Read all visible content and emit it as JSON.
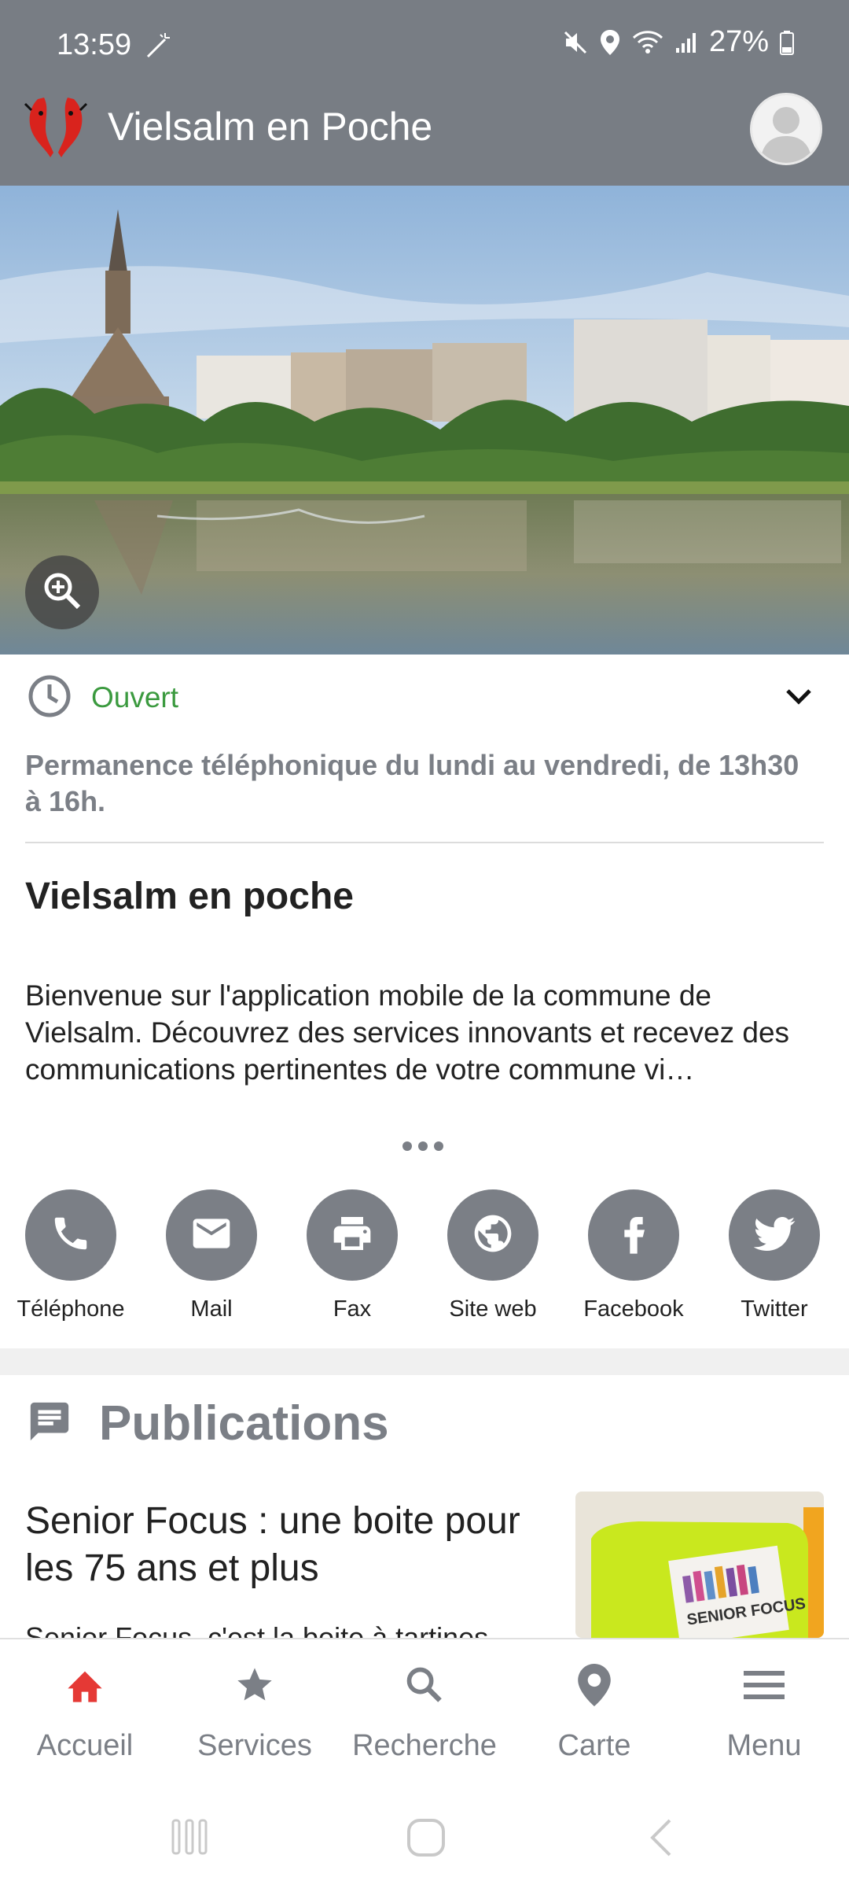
{
  "status_bar": {
    "time": "13:59",
    "battery": "27%"
  },
  "app_bar": {
    "title": "Vielsalm en Poche"
  },
  "hours": {
    "status": "Ouvert",
    "note": "Permanence téléphonique du lundi au vendredi, de 13h30 à 16h."
  },
  "main": {
    "title": "Vielsalm en poche",
    "intro": "Bienvenue sur l'application mobile de la commune de Vielsalm. Découvrez des services innovants et recevez des communications pertinentes de votre commune vi…"
  },
  "contacts": [
    {
      "label": "Téléphone",
      "icon": "phone-icon"
    },
    {
      "label": "Mail",
      "icon": "mail-icon"
    },
    {
      "label": "Fax",
      "icon": "printer-icon"
    },
    {
      "label": "Site web",
      "icon": "globe-icon"
    },
    {
      "label": "Facebook",
      "icon": "facebook-icon"
    },
    {
      "label": "Twitter",
      "icon": "twitter-icon"
    }
  ],
  "publications": {
    "title": "Publications",
    "items": [
      {
        "title": "Senior Focus : une boite pour les 75 ans et plus",
        "snippet": "Senior Focus, c'est la boite à tartines",
        "thumb_text": "SENIOR FOCUS"
      }
    ]
  },
  "bottom_nav": [
    {
      "label": "Accueil",
      "icon": "home-icon",
      "active": true
    },
    {
      "label": "Services",
      "icon": "star-icon",
      "active": false
    },
    {
      "label": "Recherche",
      "icon": "search-icon",
      "active": false
    },
    {
      "label": "Carte",
      "icon": "map-pin-icon",
      "active": false
    },
    {
      "label": "Menu",
      "icon": "menu-icon",
      "active": false
    }
  ],
  "colors": {
    "bar": "#787d84",
    "accent_active": "#e53935",
    "open_green": "#3b9a3f",
    "icon_grey": "#7b7f86"
  }
}
